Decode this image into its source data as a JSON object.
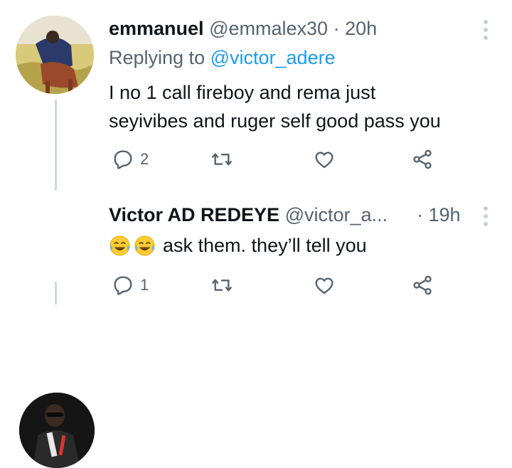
{
  "tweets": [
    {
      "display_name": "emmanuel",
      "handle": "@emmalex30",
      "separator": "·",
      "time": "20h",
      "replying_prefix": "Replying to",
      "replying_handle": "@victor_adere",
      "text_line1": "I no 1 call fireboy and rema just",
      "text_line2": "seyivibes and ruger self good pass you",
      "reply_count": "2",
      "retweet_count": "",
      "like_count": ""
    },
    {
      "display_name": "Victor AD REDEYE",
      "handle": "@victor_a...",
      "separator": "·",
      "time": "19h",
      "emoji_count": 2,
      "text": "ask them. they’ll tell you",
      "reply_count": "1",
      "retweet_count": "",
      "like_count": ""
    }
  ],
  "icons": {
    "reply": "reply-icon",
    "retweet": "retweet-icon",
    "like": "heart-icon",
    "share": "share-icon",
    "more": "more-options-icon",
    "emoji": "tears-of-joy-emoji"
  },
  "colors": {
    "link": "#1d9bf0",
    "muted": "#536471",
    "thread_line": "#cfd9de"
  }
}
